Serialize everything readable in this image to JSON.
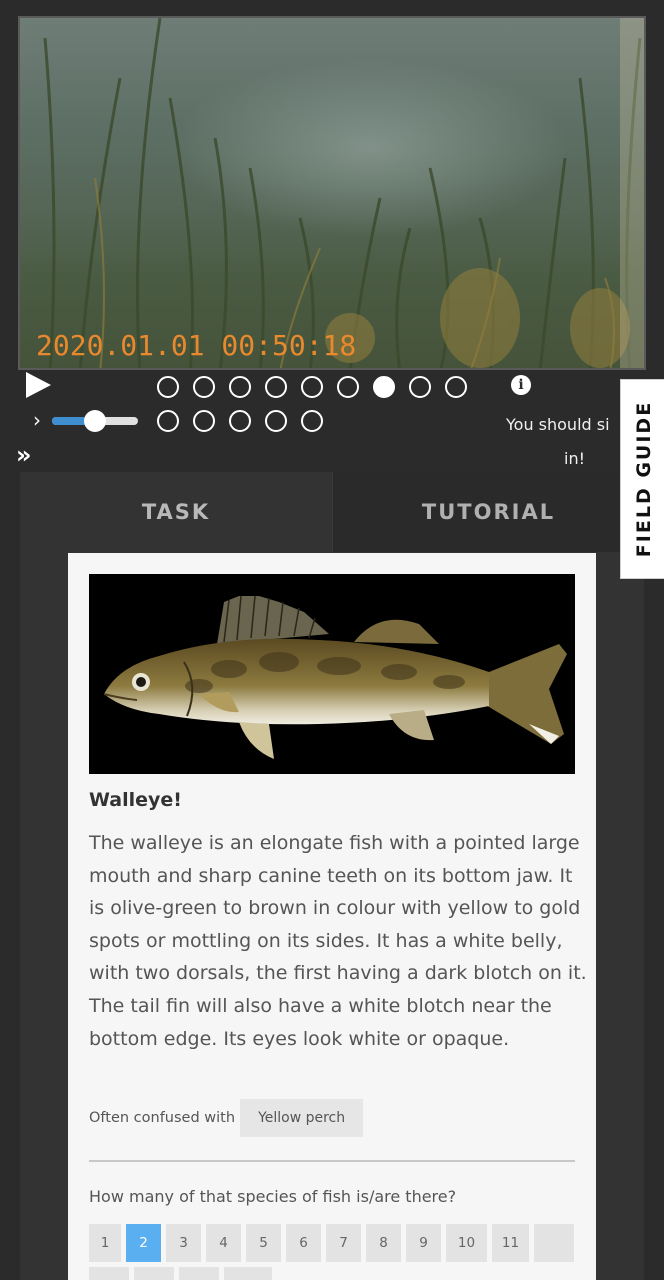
{
  "video": {
    "timestamp": "2020.01.01 00:50:18"
  },
  "player": {
    "play_icon": "play-icon",
    "info_icon": "info-icon",
    "info_glyph": "i",
    "speed_icon": "chevron-right-icon",
    "speed_glyph": "›",
    "speed_slider_value": 0.5,
    "expand_icon": "double-chevron-right-icon",
    "expand_glyph": "»",
    "hint_line1": "You should si",
    "hint_line2": "in!",
    "frames": {
      "row1_count": 9,
      "row2_count": 5,
      "active_index": 6
    }
  },
  "tabs": {
    "task": "TASK",
    "tutorial": "TUTORIAL"
  },
  "field_guide": {
    "label": "FIELD GUIDE"
  },
  "species": {
    "name": "Walleye!",
    "description": "The walleye is an elongate fish with a pointed large mouth and sharp canine teeth on its bottom jaw. It is olive-green to brown in colour with yellow to gold spots or mottling on its sides. It has a white belly, with two dorsals, the first having a dark blotch on it. The tail fin will also have a white blotch near the bottom edge. Its eyes look white or opaque.",
    "confused_label": "Often confused with",
    "confused_with": "Yellow perch"
  },
  "question": {
    "text": "How many of that species of fish is/are there?",
    "options": [
      "1",
      "2",
      "3",
      "4",
      "5",
      "6",
      "7",
      "8",
      "9",
      "10",
      "11",
      "",
      "",
      "",
      "",
      ""
    ],
    "selected": "2"
  },
  "colors": {
    "timestamp": "#e8892e",
    "selected_count": "#5aaff0",
    "slider_fill": "#3e8ed0"
  }
}
